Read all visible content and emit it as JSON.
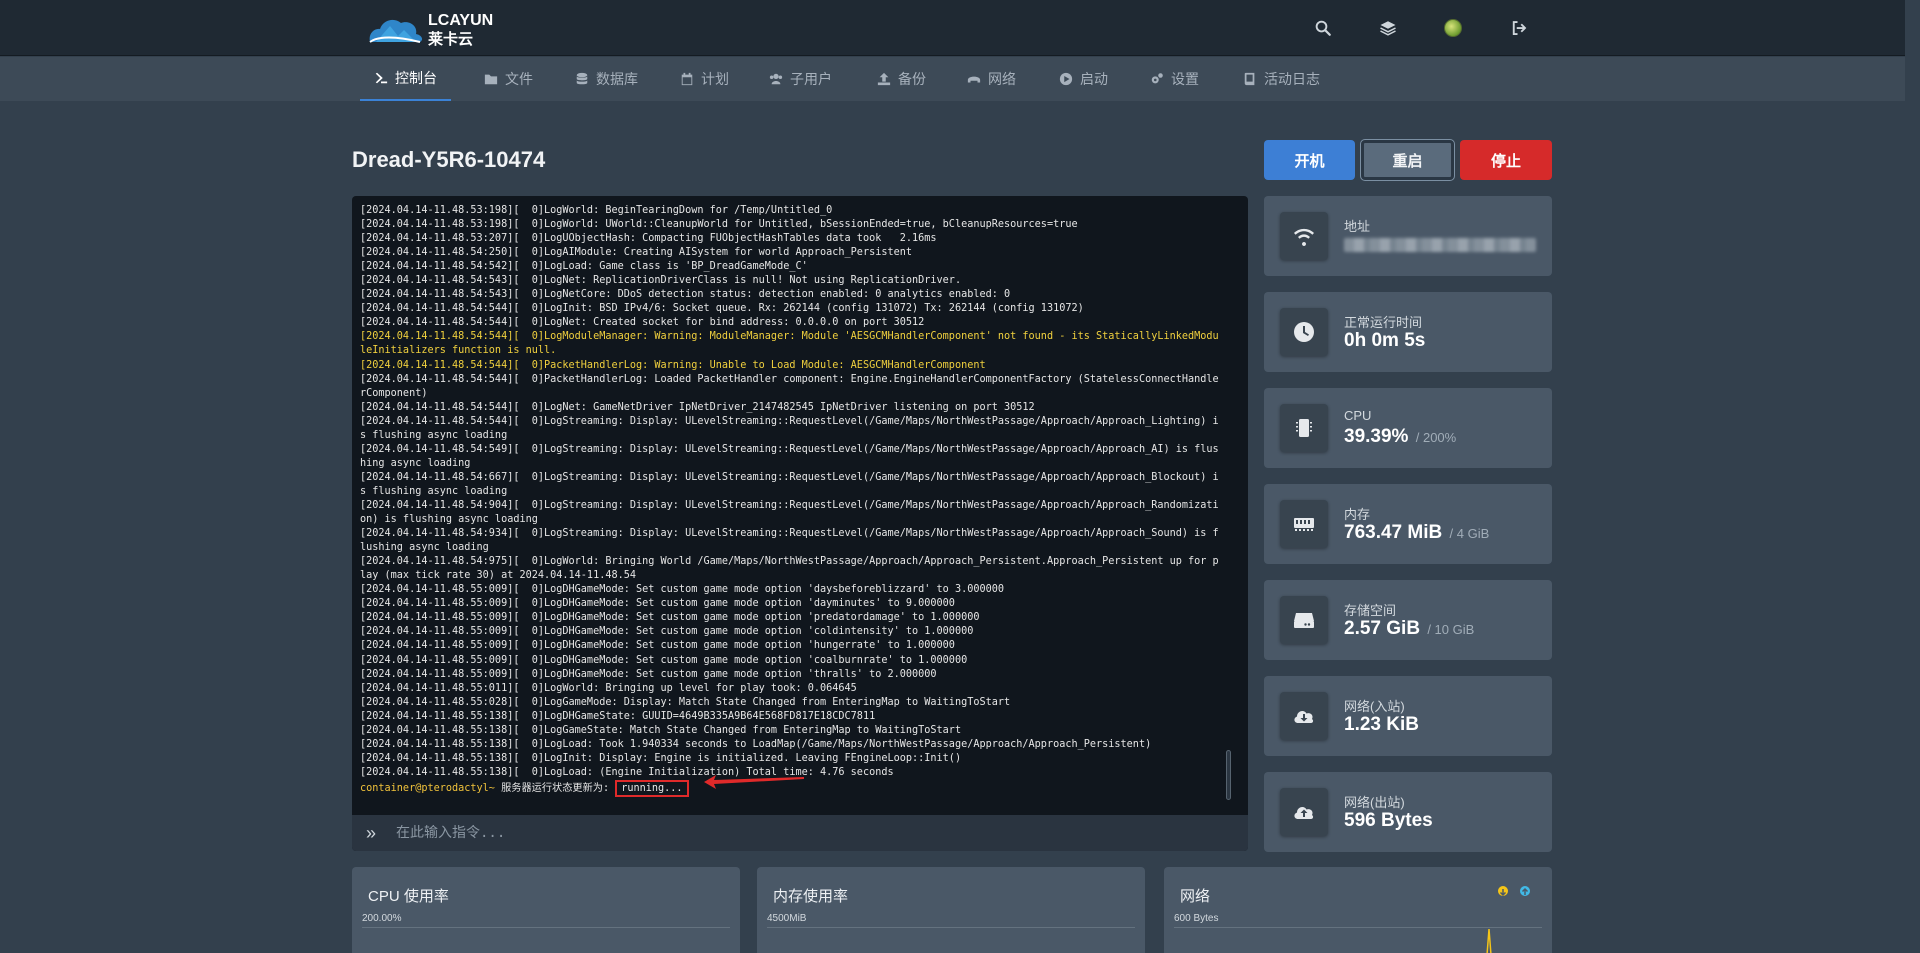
{
  "brand": {
    "name": "LCAYUN",
    "subtitle": "莱卡云"
  },
  "nav": [
    {
      "label": "控制台",
      "icon": "terminal-icon",
      "active": true
    },
    {
      "label": "文件",
      "icon": "folder-icon"
    },
    {
      "label": "数据库",
      "icon": "database-icon"
    },
    {
      "label": "计划",
      "icon": "calendar-icon"
    },
    {
      "label": "子用户",
      "icon": "users-icon"
    },
    {
      "label": "备份",
      "icon": "upload-icon"
    },
    {
      "label": "网络",
      "icon": "network-icon"
    },
    {
      "label": "启动",
      "icon": "play-icon"
    },
    {
      "label": "设置",
      "icon": "cogs-icon"
    },
    {
      "label": "活动日志",
      "icon": "book-icon"
    }
  ],
  "server": {
    "name": "Dread-Y5R6-10474"
  },
  "power": {
    "start": "开机",
    "restart": "重启",
    "stop": "停止"
  },
  "console": {
    "lines": [
      {
        "text": "[2024.04.14-11.48.53:198][  0]LogWorld: BeginTearingDown for /Temp/Untitled_0"
      },
      {
        "text": "[2024.04.14-11.48.53:198][  0]LogWorld: UWorld::CleanupWorld for Untitled, bSessionEnded=true, bCleanupResources=true"
      },
      {
        "text": "[2024.04.14-11.48.53:207][  0]LogUObjectHash: Compacting FUObjectHashTables data took   2.16ms"
      },
      {
        "text": "[2024.04.14-11.48.54:250][  0]LogAIModule: Creating AISystem for world Approach_Persistent"
      },
      {
        "text": "[2024.04.14-11.48.54:542][  0]LogLoad: Game class is 'BP_DreadGameMode_C'"
      },
      {
        "text": "[2024.04.14-11.48.54:543][  0]LogNet: ReplicationDriverClass is null! Not using ReplicationDriver."
      },
      {
        "text": "[2024.04.14-11.48.54:543][  0]LogNetCore: DDoS detection status: detection enabled: 0 analytics enabled: 0"
      },
      {
        "text": "[2024.04.14-11.48.54:544][  0]LogInit: BSD IPv4/6: Socket queue. Rx: 262144 (config 131072) Tx: 262144 (config 131072)"
      },
      {
        "text": "[2024.04.14-11.48.54:544][  0]LogNet: Created socket for bind address: 0.0.0.0 on port 30512"
      },
      {
        "text": "[2024.04.14-11.48.54:544][  0]LogModuleManager: Warning: ModuleManager: Module 'AESGCMHandlerComponent' not found - its StaticallyLinkedModuleInitializers function is null.",
        "warn": true
      },
      {
        "text": "[2024.04.14-11.48.54:544][  0]PacketHandlerLog: Warning: Unable to Load Module: AESGCMHandlerComponent",
        "warn": true
      },
      {
        "text": "[2024.04.14-11.48.54:544][  0]PacketHandlerLog: Loaded PacketHandler component: Engine.EngineHandlerComponentFactory (StatelessConnectHandlerComponent)"
      },
      {
        "text": "[2024.04.14-11.48.54:544][  0]LogNet: GameNetDriver IpNetDriver_2147482545 IpNetDriver listening on port 30512"
      },
      {
        "text": "[2024.04.14-11.48.54:544][  0]LogStreaming: Display: ULevelStreaming::RequestLevel(/Game/Maps/NorthWestPassage/Approach/Approach_Lighting) is flushing async loading"
      },
      {
        "text": "[2024.04.14-11.48.54:549][  0]LogStreaming: Display: ULevelStreaming::RequestLevel(/Game/Maps/NorthWestPassage/Approach/Approach_AI) is flushing async loading"
      },
      {
        "text": "[2024.04.14-11.48.54:667][  0]LogStreaming: Display: ULevelStreaming::RequestLevel(/Game/Maps/NorthWestPassage/Approach/Approach_Blockout) is flushing async loading"
      },
      {
        "text": "[2024.04.14-11.48.54:904][  0]LogStreaming: Display: ULevelStreaming::RequestLevel(/Game/Maps/NorthWestPassage/Approach/Approach_Randomization) is flushing async loading"
      },
      {
        "text": "[2024.04.14-11.48.54:934][  0]LogStreaming: Display: ULevelStreaming::RequestLevel(/Game/Maps/NorthWestPassage/Approach/Approach_Sound) is flushing async loading"
      },
      {
        "text": "[2024.04.14-11.48.54:975][  0]LogWorld: Bringing World /Game/Maps/NorthWestPassage/Approach/Approach_Persistent.Approach_Persistent up for play (max tick rate 30) at 2024.04.14-11.48.54"
      },
      {
        "text": "[2024.04.14-11.48.55:009][  0]LogDHGameMode: Set custom game mode option 'daysbeforeblizzard' to 3.000000"
      },
      {
        "text": "[2024.04.14-11.48.55:009][  0]LogDHGameMode: Set custom game mode option 'dayminutes' to 9.000000"
      },
      {
        "text": "[2024.04.14-11.48.55:009][  0]LogDHGameMode: Set custom game mode option 'predatordamage' to 1.000000"
      },
      {
        "text": "[2024.04.14-11.48.55:009][  0]LogDHGameMode: Set custom game mode option 'coldintensity' to 1.000000"
      },
      {
        "text": "[2024.04.14-11.48.55:009][  0]LogDHGameMode: Set custom game mode option 'hungerrate' to 1.000000"
      },
      {
        "text": "[2024.04.14-11.48.55:009][  0]LogDHGameMode: Set custom game mode option 'coalburnrate' to 1.000000"
      },
      {
        "text": "[2024.04.14-11.48.55:009][  0]LogDHGameMode: Set custom game mode option 'thralls' to 2.000000"
      },
      {
        "text": "[2024.04.14-11.48.55:011][  0]LogWorld: Bringing up level for play took: 0.064645"
      },
      {
        "text": "[2024.04.14-11.48.55:028][  0]LogGameMode: Display: Match State Changed from EnteringMap to WaitingToStart"
      },
      {
        "text": "[2024.04.14-11.48.55:138][  0]LogDHGameState: GUUID=4649B335A9B64E568FD817E18CDC7811"
      },
      {
        "text": "[2024.04.14-11.48.55:138][  0]LogGameState: Match State Changed from EnteringMap to WaitingToStart"
      },
      {
        "text": "[2024.04.14-11.48.55:138][  0]LogLoad: Took 1.940334 seconds to LoadMap(/Game/Maps/NorthWestPassage/Approach/Approach_Persistent)"
      },
      {
        "text": "[2024.04.14-11.48.55:138][  0]LogInit: Display: Engine is initialized. Leaving FEngineLoop::Init()"
      },
      {
        "text": "[2024.04.14-11.48.55:138][  0]LogLoad: (Engine Initialization) Total time: 4.76 seconds"
      }
    ],
    "prompt_user": "container@pterodactyl~",
    "prompt_message": " 服务器运行状态更新为: ",
    "prompt_status": "running...",
    "command_placeholder": "在此输入指令..."
  },
  "stats": [
    {
      "label": "地址",
      "icon": "wifi-icon",
      "value": "",
      "blurred": true
    },
    {
      "label": "正常运行时间",
      "icon": "clock-icon",
      "value": "0h 0m 5s",
      "max": ""
    },
    {
      "label": "CPU",
      "icon": "microchip-icon",
      "value": "39.39%",
      "max": "/ 200%"
    },
    {
      "label": "内存",
      "icon": "memory-icon",
      "value": "763.47 MiB",
      "max": "/ 4 GiB"
    },
    {
      "label": "存储空间",
      "icon": "hdd-icon",
      "value": "2.57 GiB",
      "max": "/ 10 GiB"
    },
    {
      "label": "网络(入站)",
      "icon": "cloud-download-icon",
      "value": "1.23 KiB",
      "max": ""
    },
    {
      "label": "网络(出站)",
      "icon": "cloud-upload-icon",
      "value": "596 Bytes",
      "max": ""
    }
  ],
  "graphs": [
    {
      "title": "CPU 使用率",
      "ytick": "200.00%"
    },
    {
      "title": "内存使用率",
      "ytick": "4500MiB"
    },
    {
      "title": "网络",
      "ytick": "600 Bytes"
    }
  ],
  "colors": {
    "accent": "#3d7fd5",
    "danger": "#d62a2a",
    "warning": "#f0d03e",
    "network_in": "#f5c518",
    "network_out": "#41b9e6"
  }
}
